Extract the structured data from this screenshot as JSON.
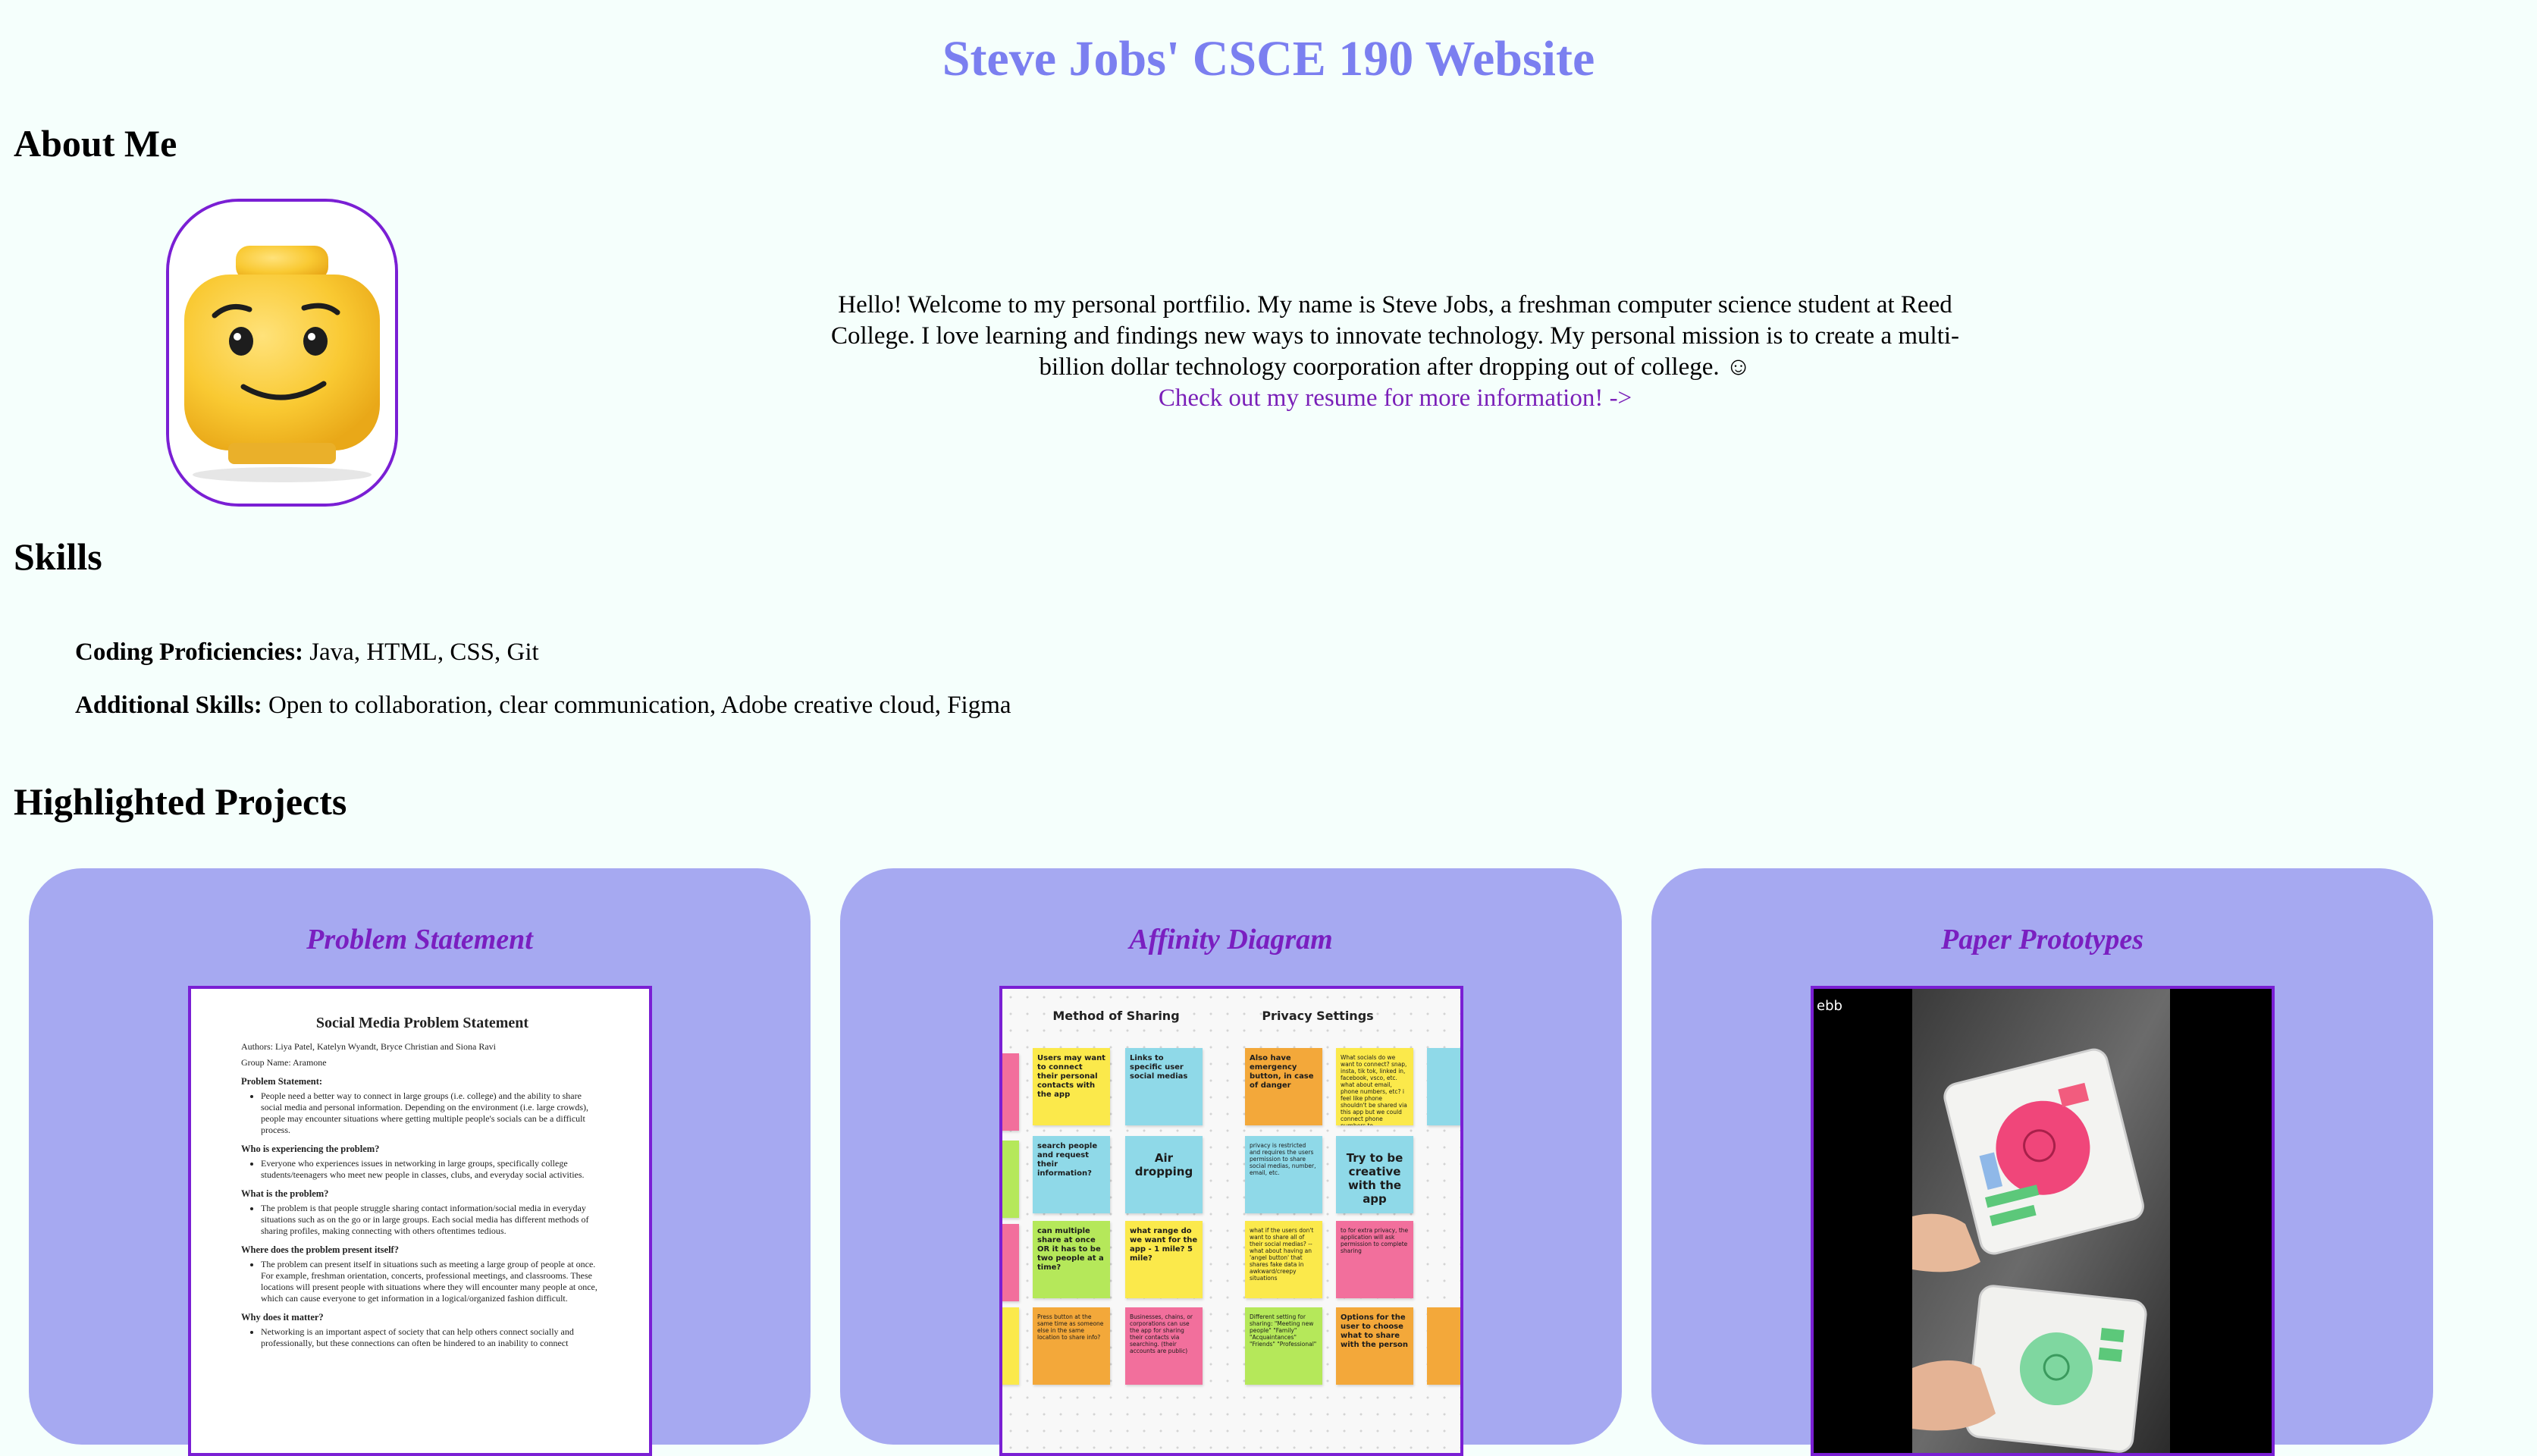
{
  "site": {
    "title": "Steve Jobs' CSCE 190 Website"
  },
  "about": {
    "heading": "About Me",
    "intro": "Hello! Welcome to my personal portfilio. My name is Steve Jobs, a freshman computer science student at Reed College. I love learning and findings new ways to innovate technology. My personal mission is to create a multi-billion dollar technology coorporation after dropping out of college. ☺",
    "resume_link": "Check out my resume for more information! ->"
  },
  "skills": {
    "heading": "Skills",
    "coding_label": "Coding Proficiencies:",
    "coding_value": " Java, HTML, CSS, Git",
    "additional_label": "Additional Skills:",
    "additional_value": " Open to collaboration, clear communication, Adobe creative cloud, Figma"
  },
  "projects": {
    "heading": "Highlighted Projects",
    "cards": [
      {
        "title": "Problem Statement",
        "doc": {
          "title": "Social Media Problem Statement",
          "authors": "Authors: Liya Patel, Katelyn Wyandt, Bryce Christian and Siona Ravi",
          "group": "Group Name: Aramone",
          "sections": [
            {
              "heading": "Problem Statement:",
              "text": "People need a better way to connect in large groups (i.e. college) and the ability to share social media and personal information. Depending on the environment (i.e. large crowds), people may encounter situations where getting multiple people's socials can be a difficult process."
            },
            {
              "heading": "Who is experiencing the problem?",
              "text": "Everyone who experiences issues in networking in large groups, specifically college students/teenagers who meet new people in classes, clubs, and everyday social activities."
            },
            {
              "heading": "What is the problem?",
              "text": "The problem is that people struggle sharing contact information/social media in everyday situations such as on the go or in large groups. Each social media has different methods of sharing profiles, making connecting with others oftentimes tedious."
            },
            {
              "heading": "Where does the problem present itself?",
              "text": "The problem can present itself in situations such as meeting a large group of people at once. For example, freshman orientation, concerts, professional meetings, and classrooms. These locations will present people with situations where they will encounter many people at once, which can cause everyone to get information in a logical/organized fashion difficult."
            },
            {
              "heading": "Why does it matter?",
              "text": "Networking is an important aspect of society that can help others connect socially and professionally, but these connections can often be hindered to an inability to connect"
            }
          ]
        }
      },
      {
        "title": "Affinity Diagram",
        "board": {
          "col1": "Method of Sharing",
          "col2": "Privacy Settings",
          "notes": [
            "Users may want to connect their personal contacts with the app",
            "Links to specific user social medias",
            "search people and request their information?",
            "Air dropping",
            "can multiple share at once OR it has to be two people at a time?",
            "what range do we want for the app - 1 mile? 5 mile?",
            "Press button at the same time as someone else in the same location to share info?",
            "Businesses, chains, or corporations can use the app for sharing their contacts via searching. (their accounts are public)",
            "Also have emergency button, in case of danger",
            "What socials do we want to connect? snap, insta, tik tok, linked in, facebook, vsco, etc. what about email, phone numbers, etc? i feel like phone shouldn't be shared via this app but we could connect phone numbers to",
            "privacy is restricted and requires the users permission to share social medias, number, email, etc.",
            "Try to be creative with the app",
            "what if the users don't want to share all of their social medias? --what about having an 'angel button' that shares fake data in awkward/creepy situations",
            "to for extra privacy, the application will ask permission to complete sharing",
            "Different setting for sharing: \"Meeting new people\" \"Family\" \"Acquaintances\" \"Friends\" \"Professional\"",
            "Options for the user to choose what to share with the person"
          ]
        }
      },
      {
        "title": "Paper Prototypes",
        "video_label": "ebb"
      }
    ]
  },
  "colors": {
    "background": "#f5fffc",
    "title": "#7b7ff0",
    "accent_purple": "#7a1fd4",
    "card": "#a6a9f1",
    "note_yellow": "#fbe94b",
    "note_blue": "#8fd9e8",
    "note_orange": "#f3a83a",
    "note_green": "#b5e85a",
    "note_pink": "#f26f9c"
  }
}
